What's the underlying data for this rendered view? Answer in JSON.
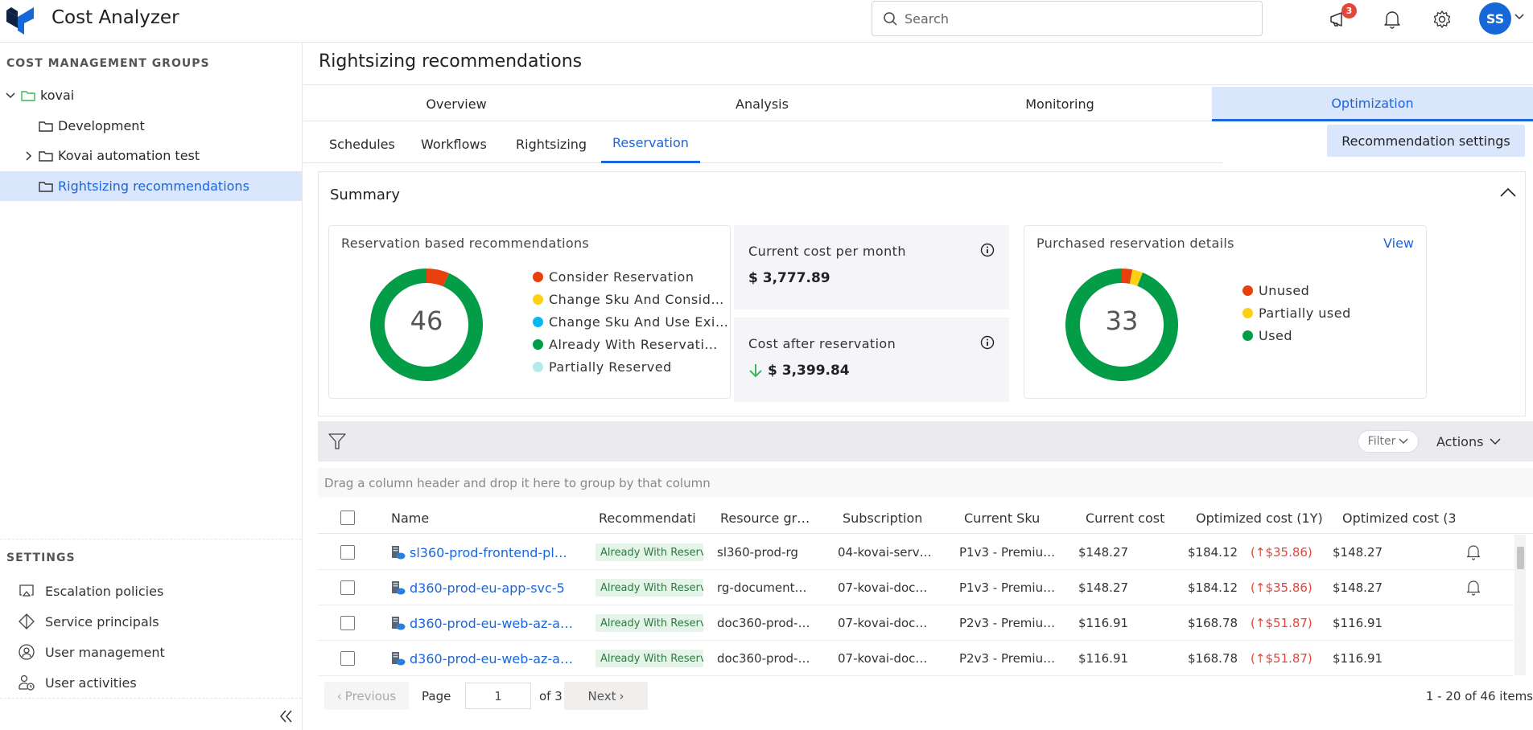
{
  "header": {
    "app_title": "Cost Analyzer",
    "search_placeholder": "Search",
    "search_value": "",
    "announcement_badge": "3",
    "avatar_initials": "SS",
    "brand_color": "#1668d8"
  },
  "sidebar": {
    "groups_heading": "COST MANAGEMENT GROUPS",
    "tree": [
      {
        "label": "kovai",
        "expanded": true
      },
      {
        "label": "Development"
      },
      {
        "label": "Kovai automation test",
        "expanded": false
      },
      {
        "label": "Rightsizing recommendations",
        "selected": true
      }
    ],
    "settings_heading": "SETTINGS",
    "settings": [
      {
        "label": "Escalation policies",
        "icon": "escalation-icon"
      },
      {
        "label": "Service principals",
        "icon": "service-principal-icon"
      },
      {
        "label": "User management",
        "icon": "user-circle-icon"
      },
      {
        "label": "User activities",
        "icon": "user-clock-icon"
      }
    ]
  },
  "page": {
    "title": "Rightsizing recommendations",
    "main_tabs": [
      {
        "label": "Overview"
      },
      {
        "label": "Analysis"
      },
      {
        "label": "Monitoring"
      },
      {
        "label": "Optimization",
        "active": true
      }
    ],
    "sub_tabs": [
      {
        "label": "Schedules"
      },
      {
        "label": "Workflows"
      },
      {
        "label": "Rightsizing"
      },
      {
        "label": "Reservation",
        "active": true
      }
    ],
    "recommendation_settings_label": "Recommendation settings"
  },
  "summary": {
    "title": "Summary",
    "current_cost_label": "Current cost per month",
    "current_cost_value": "$ 3,777.89",
    "after_cost_label": "Cost after reservation",
    "after_cost_value": "$ 3,399.84",
    "view_label": "View"
  },
  "chart_data": [
    {
      "type": "pie",
      "title": "Reservation based recommendations",
      "total_label": "46",
      "categories": [
        "Consider Reservation",
        "Change Sku And Consid…",
        "Change Sku And Use Exi…",
        "Already With Reservati…",
        "Partially Reserved"
      ],
      "values": [
        3,
        0,
        0,
        43,
        0
      ],
      "colors": [
        "#e8400c",
        "#fdd016",
        "#0bb5f0",
        "#039d48",
        "#b2ebe9"
      ]
    },
    {
      "type": "pie",
      "title": "Purchased reservation details",
      "total_label": "33",
      "categories": [
        "Unused",
        "Partially used",
        "Used"
      ],
      "values": [
        1,
        1,
        31
      ],
      "colors": [
        "#e8400c",
        "#fdd016",
        "#039d48"
      ]
    }
  ],
  "grid": {
    "filter_label": "Filter",
    "actions_label": "Actions",
    "group_hint": "Drag a column header and drop it here to group by that column",
    "columns": [
      "Name",
      "Recommendati",
      "Resource gr…",
      "Subscription",
      "Current Sku",
      "Current cost",
      "Optimized cost (1Y)",
      "Optimized cost (3"
    ],
    "rows": [
      {
        "name": "sl360-prod-frontend-pl…",
        "recommendation": "Already With Reserv",
        "resource_group": "sl360-prod-rg",
        "subscription": "04-kovai-serv…",
        "sku": "P1v3 - Premiu…",
        "current_cost": "$148.27",
        "opt_1y": "$184.12",
        "opt_1y_diff": "(↑$35.86)",
        "opt_3y": "$148.27",
        "alert": true
      },
      {
        "name": "d360-prod-eu-app-svc-5",
        "recommendation": "Already With Reserv",
        "resource_group": "rg-document…",
        "subscription": "07-kovai-doc…",
        "sku": "P1v3 - Premiu…",
        "current_cost": "$148.27",
        "opt_1y": "$184.12",
        "opt_1y_diff": "(↑$35.86)",
        "opt_3y": "$148.27",
        "alert": true
      },
      {
        "name": "d360-prod-eu-web-az-a…",
        "recommendation": "Already With Reserv",
        "resource_group": "doc360-prod-…",
        "subscription": "07-kovai-doc…",
        "sku": "P2v3 - Premiu…",
        "current_cost": "$116.91",
        "opt_1y": "$168.78",
        "opt_1y_diff": "(↑$51.87)",
        "opt_3y": "$116.91",
        "alert": false
      },
      {
        "name": "d360-prod-eu-web-az-a…",
        "recommendation": "Already With Reserv",
        "resource_group": "doc360-prod-…",
        "subscription": "07-kovai-doc…",
        "sku": "P2v3 - Premiu…",
        "current_cost": "$116.91",
        "opt_1y": "$168.78",
        "opt_1y_diff": "(↑$51.87)",
        "opt_3y": "$116.91",
        "alert": false
      }
    ]
  },
  "pager": {
    "previous_label": "Previous",
    "page_label": "Page",
    "page_value": "1",
    "of_label": "of 3",
    "next_label": "Next",
    "items_label": "1 - 20 of 46 items"
  }
}
